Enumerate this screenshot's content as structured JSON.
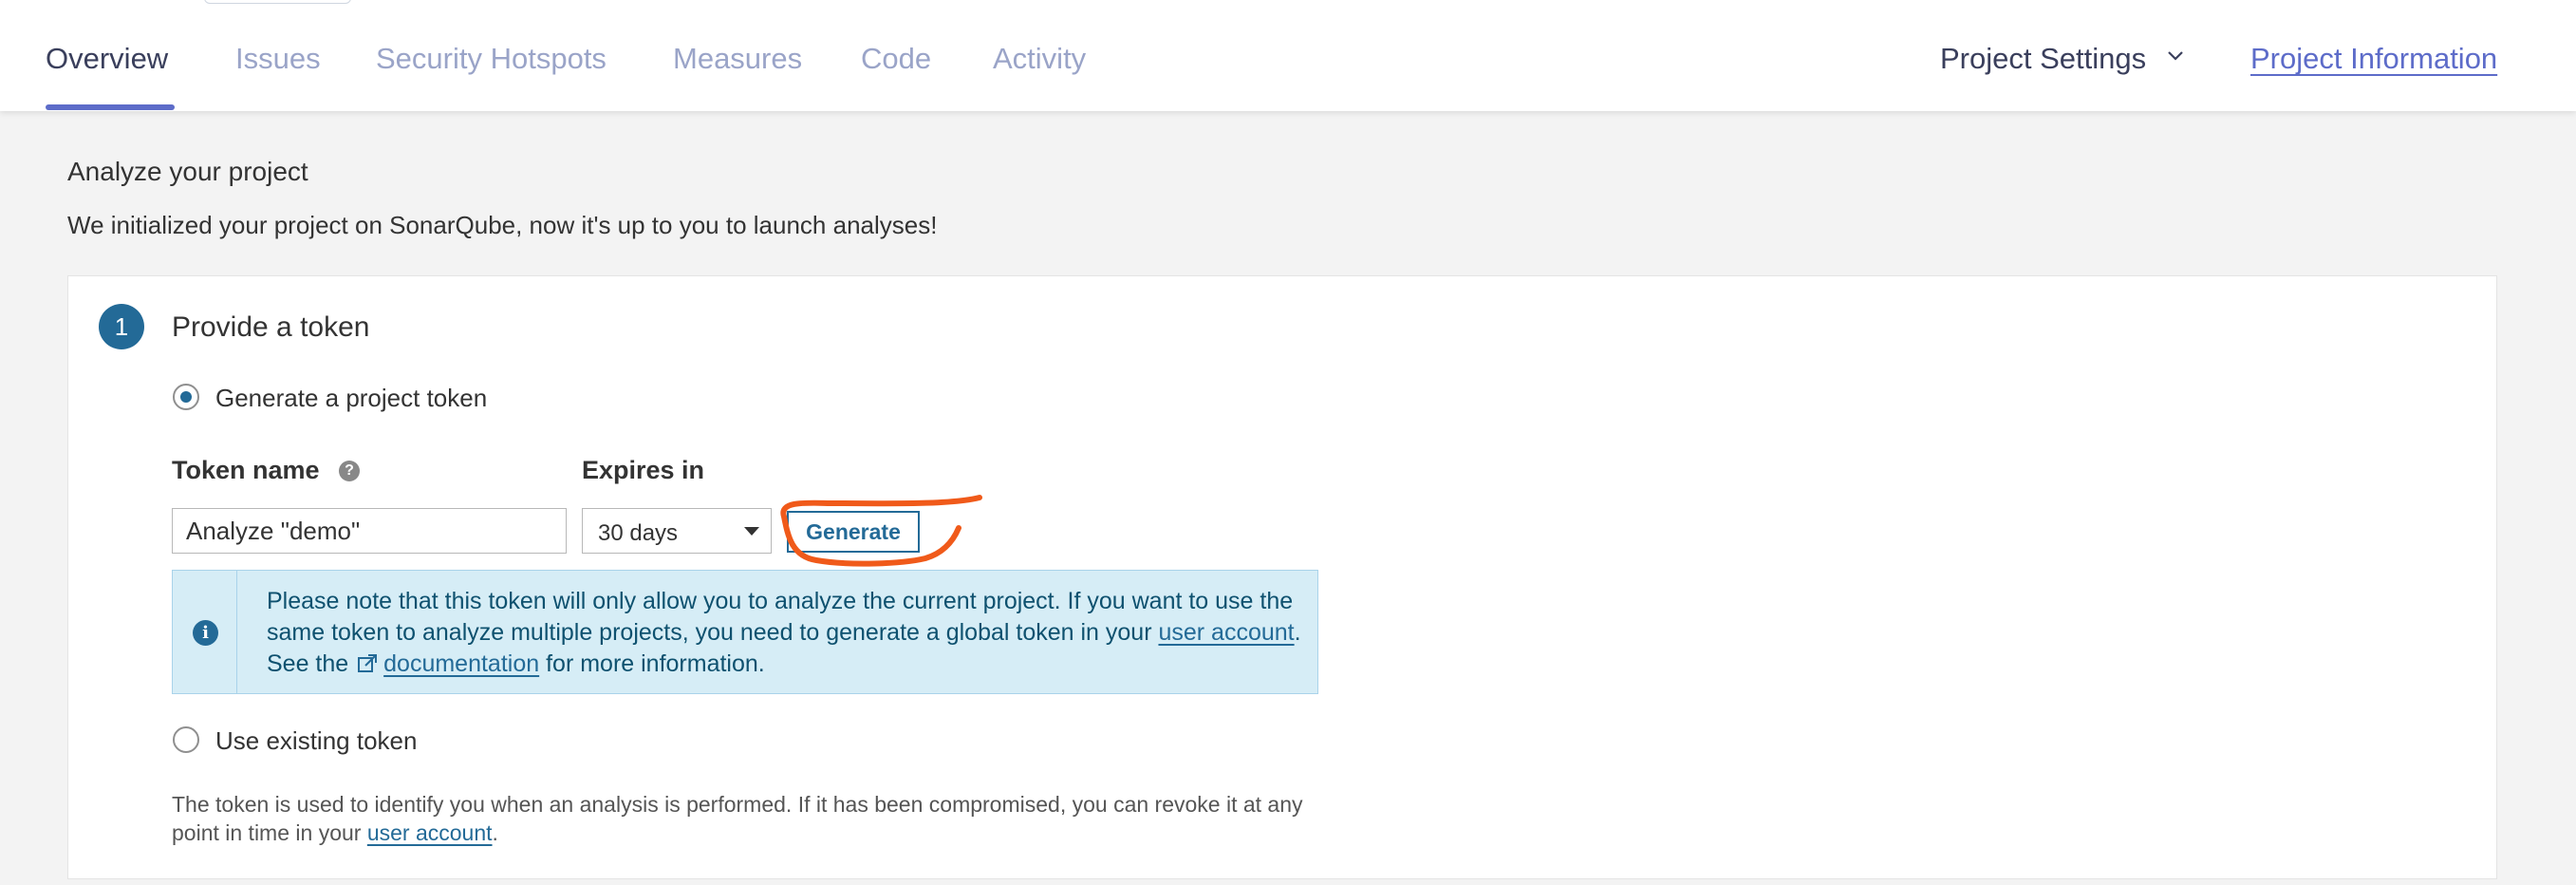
{
  "nav": {
    "tabs": [
      {
        "label": "Overview",
        "active": true
      },
      {
        "label": "Issues",
        "active": false
      },
      {
        "label": "Security Hotspots",
        "active": false
      },
      {
        "label": "Measures",
        "active": false
      },
      {
        "label": "Code",
        "active": false
      },
      {
        "label": "Activity",
        "active": false
      }
    ],
    "project_settings": "Project Settings",
    "project_information": "Project Information"
  },
  "page": {
    "title": "Analyze your project",
    "subtitle": "We initialized your project on SonarQube, now it's up to you to launch analyses!"
  },
  "step": {
    "number": "1",
    "title": "Provide a token",
    "option_generate": "Generate a project token",
    "option_existing": "Use existing token",
    "selected_option": "generate",
    "token_name_label": "Token name",
    "token_name_value": "Analyze \"demo\"",
    "expires_label": "Expires in",
    "expires_value": "30 days",
    "generate_button": "Generate",
    "info": {
      "text_1": "Please note that this token will only allow you to analyze the current project. If you want to use the same token to analyze multiple projects, you need to generate a global token in your ",
      "link_user_account": "user account",
      "text_2": ". See the ",
      "link_documentation": "documentation",
      "text_3": " for more information."
    },
    "footnote": {
      "text_1": "The token is used to identify you when an analysis is performed. If it has been compromised, you can revoke it at any point in time in your ",
      "link_user_account": "user account",
      "text_2": "."
    }
  },
  "colors": {
    "accent": "#5d6cc9",
    "primary": "#236a97",
    "info_bg": "#d6edf6",
    "annotation": "#f05a1a"
  }
}
